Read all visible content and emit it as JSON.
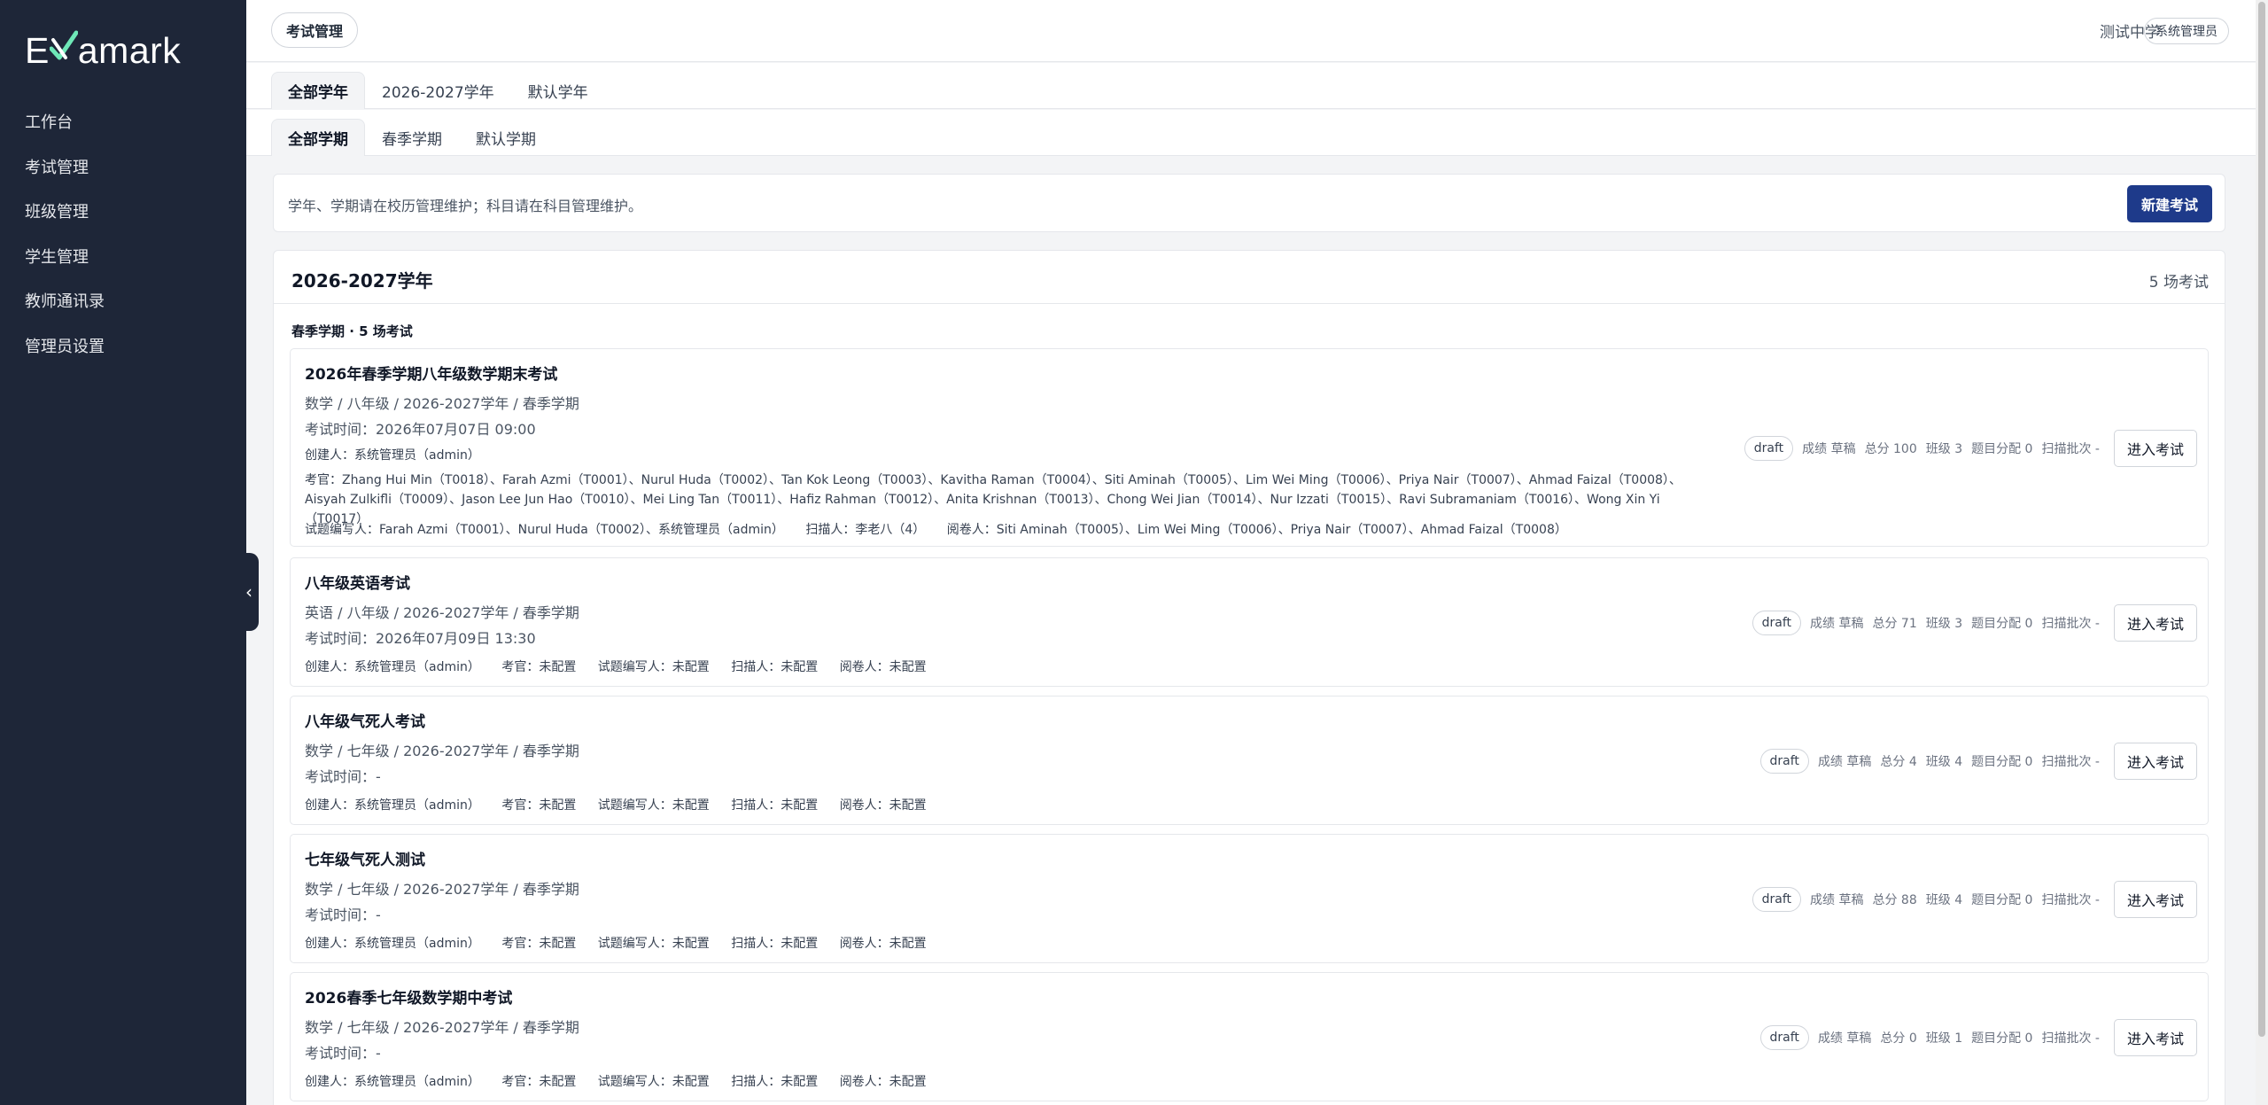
{
  "app": {
    "logo_text": "Examark"
  },
  "sidebar": {
    "items": [
      {
        "label": "工作台"
      },
      {
        "label": "考试管理"
      },
      {
        "label": "班级管理"
      },
      {
        "label": "学生管理"
      },
      {
        "label": "教师通讯录"
      },
      {
        "label": "管理员设置"
      }
    ],
    "collapse_icon": "chevron-left-icon"
  },
  "header": {
    "page_title": "考试管理",
    "school": "测试中学",
    "role": "系统管理员"
  },
  "year_tabs": [
    {
      "label": "全部学年",
      "active": true
    },
    {
      "label": "2026-2027学年",
      "active": false
    },
    {
      "label": "默认学年",
      "active": false
    }
  ],
  "term_tabs": [
    {
      "label": "全部学期",
      "active": true
    },
    {
      "label": "春季学期",
      "active": false
    },
    {
      "label": "默认学期",
      "active": false
    }
  ],
  "notice": {
    "text": "学年、学期请在校历管理维护；科目请在科目管理维护。",
    "new_button": "新建考试"
  },
  "year_group": {
    "title": "2026-2027学年",
    "count": "5 场考试",
    "term_label": "春季学期 · 5 场考试"
  },
  "exams": [
    {
      "title": "2026年春季学期八年级数学期末考试",
      "path": "数学 / 八年级 / 2026-2027学年 / 春季学期",
      "time": "考试时间：2026年07月07日 09:00",
      "creator": "创建人：系统管理员（admin）",
      "invigilators": "考官：Zhang Hui Min（T0018）、Farah Azmi（T0001）、Nurul Huda（T0002）、Tan Kok Leong（T0003）、Kavitha Raman（T0004）、Siti Aminah（T0005）、Lim Wei Ming（T0006）、Priya Nair（T0007）、Ahmad Faizal（T0008）、Aisyah Zulkifli（T0009）、Jason Lee Jun Hao（T0010）、Mei Ling Tan（T0011）、Hafiz Rahman（T0012）、Anita Krishnan（T0013）、Chong Wei Jian（T0014）、Nur Izzati（T0015）、Ravi Subramaniam（T0016）、Wong Xin Yi（T0017）",
      "writers": "试题编写人：Farah Azmi（T0001）、Nurul Huda（T0002）、系统管理员（admin）",
      "scanners": "扫描人：李老八（4）",
      "markers": "阅卷人：Siti Aminah（T0005）、Lim Wei Ming（T0006）、Priya Nair（T0007）、Ahmad Faizal（T0008）",
      "status": "draft",
      "grade_status": "成绩 草稿",
      "total": "总分 100",
      "classes": "班级 3",
      "assign": "题目分配 0",
      "scan_batch": "扫描批次 -",
      "enter": "进入考试"
    },
    {
      "title": "八年级英语考试",
      "path": "英语 / 八年级 / 2026-2027学年 / 春季学期",
      "time": "考试时间：2026年07月09日 13:30",
      "meta": [
        "创建人：系统管理员（admin）",
        "考官：未配置",
        "试题编写人：未配置",
        "扫描人：未配置",
        "阅卷人：未配置"
      ],
      "status": "draft",
      "grade_status": "成绩 草稿",
      "total": "总分 71",
      "classes": "班级 3",
      "assign": "题目分配 0",
      "scan_batch": "扫描批次 -",
      "enter": "进入考试"
    },
    {
      "title": "八年级气死人考试",
      "path": "数学 / 七年级 / 2026-2027学年 / 春季学期",
      "time": "考试时间：-",
      "meta": [
        "创建人：系统管理员（admin）",
        "考官：未配置",
        "试题编写人：未配置",
        "扫描人：未配置",
        "阅卷人：未配置"
      ],
      "status": "draft",
      "grade_status": "成绩 草稿",
      "total": "总分 4",
      "classes": "班级 4",
      "assign": "题目分配 0",
      "scan_batch": "扫描批次 -",
      "enter": "进入考试"
    },
    {
      "title": "七年级气死人测试",
      "path": "数学 / 七年级 / 2026-2027学年 / 春季学期",
      "time": "考试时间：-",
      "meta": [
        "创建人：系统管理员（admin）",
        "考官：未配置",
        "试题编写人：未配置",
        "扫描人：未配置",
        "阅卷人：未配置"
      ],
      "status": "draft",
      "grade_status": "成绩 草稿",
      "total": "总分 88",
      "classes": "班级 4",
      "assign": "题目分配 0",
      "scan_batch": "扫描批次 -",
      "enter": "进入考试"
    },
    {
      "title": "2026春季七年级数学期中考试",
      "path": "数学 / 七年级 / 2026-2027学年 / 春季学期",
      "time": "考试时间：-",
      "meta": [
        "创建人：系统管理员（admin）",
        "考官：未配置",
        "试题编写人：未配置",
        "扫描人：未配置",
        "阅卷人：未配置"
      ],
      "status": "draft",
      "grade_status": "成绩 草稿",
      "total": "总分 0",
      "classes": "班级 1",
      "assign": "题目分配 0",
      "scan_batch": "扫描批次 -",
      "enter": "进入考试"
    }
  ],
  "colors": {
    "sidebar": "#1e2638",
    "primary": "#1e3a8a",
    "background": "#f3f4f6"
  }
}
